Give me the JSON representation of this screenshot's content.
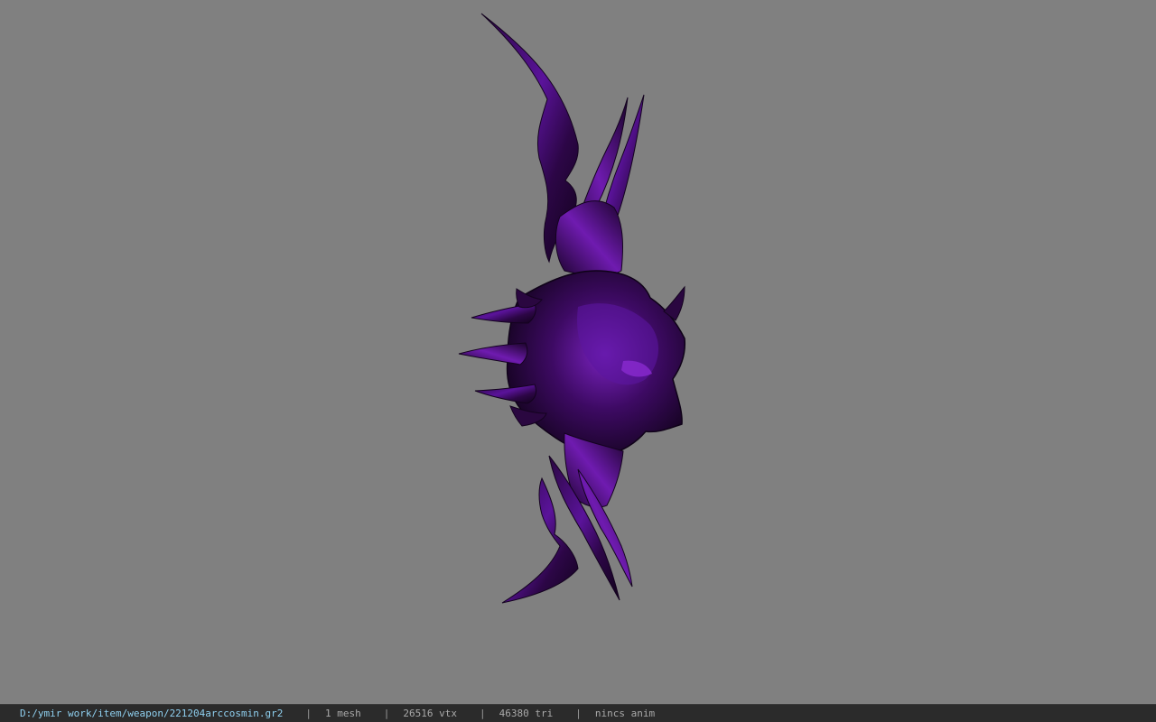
{
  "viewport": {
    "background_color": "#808080",
    "model": {
      "icon": "weapon-model",
      "primary_color": "#3a0a55",
      "highlight_color": "#7a1fb5",
      "shadow_color": "#14031f"
    }
  },
  "statusbar": {
    "file_path": "D:/ymir work/item/weapon/221204arccosmin.gr2",
    "separator": "|",
    "mesh": "1 mesh",
    "vertices": "26516 vtx",
    "triangles": "46380 tri",
    "animation": "nincs anim",
    "path_color": "#8fd0f0",
    "background_color": "#2b2b2b"
  }
}
